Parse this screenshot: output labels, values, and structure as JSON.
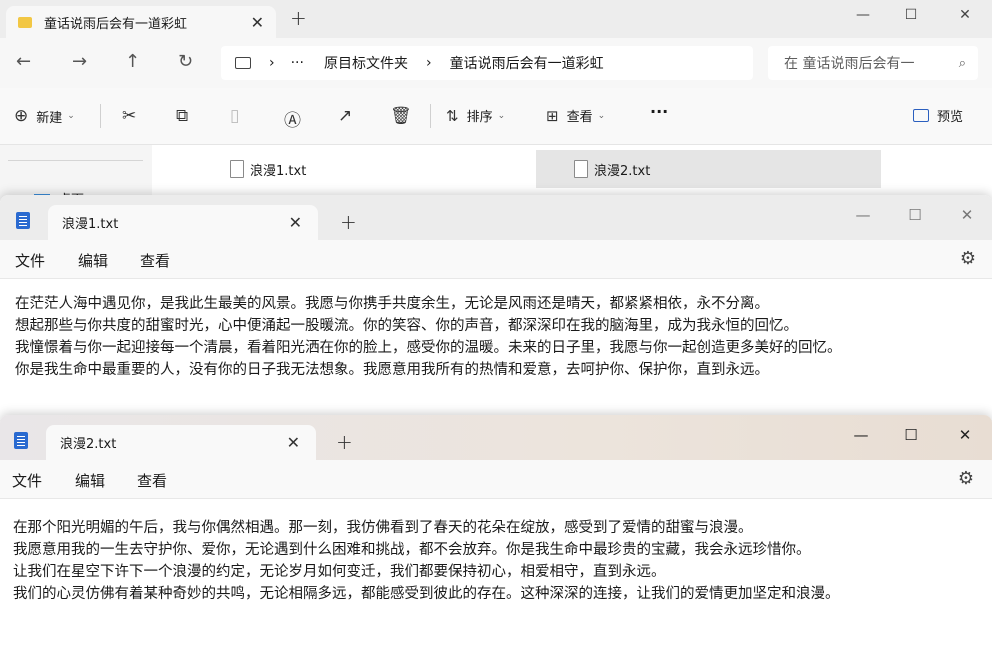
{
  "explorer": {
    "tab_title": "童话说雨后会有一道彩虹",
    "close_tab": "✕",
    "new_tab": "+",
    "controls": {
      "minimize": "—",
      "maximize": "☐",
      "close": "✕"
    },
    "nav": {
      "back": "←",
      "forward": "→",
      "up": "↑",
      "refresh": "↻"
    },
    "address": {
      "device_icon": "monitor-icon",
      "sep1": "›",
      "ellipsis": "···",
      "crumb1": "原目标文件夹",
      "sep2": "›",
      "crumb2": "童话说雨后会有一道彩虹"
    },
    "search_placeholder": "在 童话说雨后会有一",
    "toolbar": {
      "new_label": "新建",
      "sort_label": "排序",
      "view_label": "查看",
      "more": "···",
      "preview_label": "预览"
    },
    "nav_pane_item": "桌面",
    "files": [
      {
        "name": "浪漫1.txt",
        "selected": false
      },
      {
        "name": "浪漫2.txt",
        "selected": true
      }
    ]
  },
  "notepad1": {
    "tab_title": "浪漫1.txt",
    "close_tab": "✕",
    "new_tab": "+",
    "controls": {
      "minimize": "—",
      "maximize": "☐",
      "close": "✕"
    },
    "menu": {
      "file": "文件",
      "edit": "编辑",
      "view": "查看"
    },
    "lines": [
      "在茫茫人海中遇见你，是我此生最美的风景。我愿与你携手共度余生，无论是风雨还是晴天，都紧紧相依，永不分离。",
      "想起那些与你共度的甜蜜时光，心中便涌起一股暖流。你的笑容、你的声音，都深深印在我的脑海里，成为我永恒的回忆。",
      "我憧憬着与你一起迎接每一个清晨，看着阳光洒在你的脸上，感受你的温暖。未来的日子里，我愿与你一起创造更多美好的回忆。",
      "你是我生命中最重要的人，没有你的日子我无法想象。我愿意用我所有的热情和爱意，去呵护你、保护你，直到永远。"
    ]
  },
  "notepad2": {
    "tab_title": "浪漫2.txt",
    "close_tab": "✕",
    "new_tab": "+",
    "controls": {
      "minimize": "—",
      "maximize": "☐",
      "close": "✕"
    },
    "menu": {
      "file": "文件",
      "edit": "编辑",
      "view": "查看"
    },
    "lines": [
      "在那个阳光明媚的午后，我与你偶然相遇。那一刻，我仿佛看到了春天的花朵在绽放，感受到了爱情的甜蜜与浪漫。",
      "我愿意用我的一生去守护你、爱你，无论遇到什么困难和挑战，都不会放弃。你是我生命中最珍贵的宝藏，我会永远珍惜你。",
      "让我们在星空下许下一个浪漫的约定，无论岁月如何变迁，我们都要保持初心，相爱相守，直到永远。",
      "我们的心灵仿佛有着某种奇妙的共鸣，无论相隔多远，都能感受到彼此的存在。这种深深的连接，让我们的爱情更加坚定和浪漫。"
    ]
  }
}
